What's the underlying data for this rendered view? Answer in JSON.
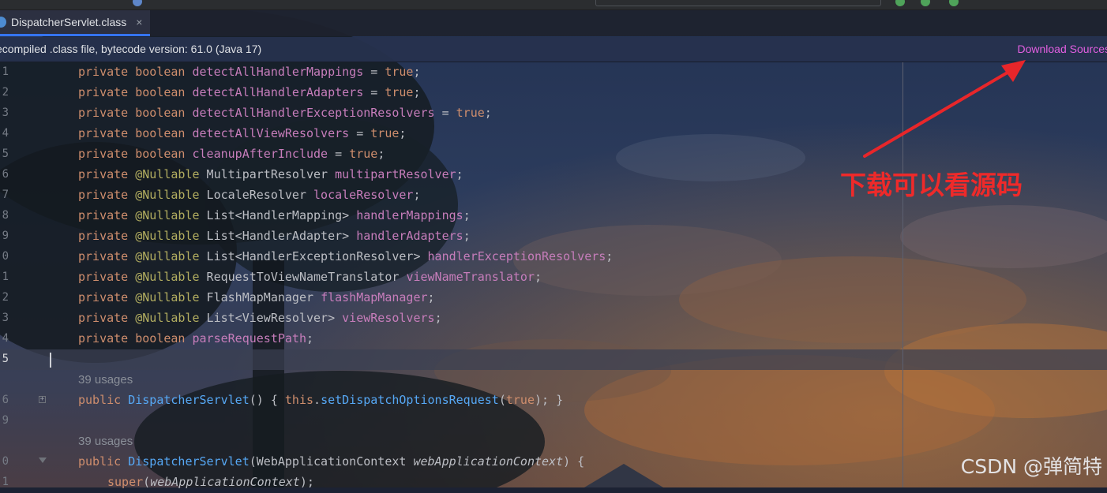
{
  "tab": {
    "label": "DispatcherServlet.class",
    "close_glyph": "×"
  },
  "notice": {
    "text": "ecompiled .class file, bytecode version: 61.0 (Java 17)",
    "action_label": "Download Sources"
  },
  "editor": {
    "lines": [
      {
        "number": "1",
        "tokens": [
          {
            "t": "private boolean ",
            "c": "kw"
          },
          {
            "t": "detectAllHandlerMappings",
            "c": "fld"
          },
          {
            "t": " = ",
            "c": ""
          },
          {
            "t": "true",
            "c": "kw"
          },
          {
            "t": ";",
            "c": ""
          }
        ]
      },
      {
        "number": "2",
        "tokens": [
          {
            "t": "private boolean ",
            "c": "kw"
          },
          {
            "t": "detectAllHandlerAdapters",
            "c": "fld"
          },
          {
            "t": " = ",
            "c": ""
          },
          {
            "t": "true",
            "c": "kw"
          },
          {
            "t": ";",
            "c": ""
          }
        ]
      },
      {
        "number": "3",
        "tokens": [
          {
            "t": "private boolean ",
            "c": "kw"
          },
          {
            "t": "detectAllHandlerExceptionResolvers",
            "c": "fld"
          },
          {
            "t": " = ",
            "c": ""
          },
          {
            "t": "true",
            "c": "kw"
          },
          {
            "t": ";",
            "c": ""
          }
        ]
      },
      {
        "number": "4",
        "tokens": [
          {
            "t": "private boolean ",
            "c": "kw"
          },
          {
            "t": "detectAllViewResolvers",
            "c": "fld"
          },
          {
            "t": " = ",
            "c": ""
          },
          {
            "t": "true",
            "c": "kw"
          },
          {
            "t": ";",
            "c": ""
          }
        ]
      },
      {
        "number": "5",
        "tokens": [
          {
            "t": "private boolean ",
            "c": "kw"
          },
          {
            "t": "cleanupAfterInclude",
            "c": "fld"
          },
          {
            "t": " = ",
            "c": ""
          },
          {
            "t": "true",
            "c": "kw"
          },
          {
            "t": ";",
            "c": ""
          }
        ]
      },
      {
        "number": "6",
        "tokens": [
          {
            "t": "private ",
            "c": "kw"
          },
          {
            "t": "@Nullable",
            "c": "ann"
          },
          {
            "t": " MultipartResolver ",
            "c": ""
          },
          {
            "t": "multipartResolver",
            "c": "fld"
          },
          {
            "t": ";",
            "c": ""
          }
        ]
      },
      {
        "number": "7",
        "tokens": [
          {
            "t": "private ",
            "c": "kw"
          },
          {
            "t": "@Nullable",
            "c": "ann"
          },
          {
            "t": " LocaleResolver ",
            "c": ""
          },
          {
            "t": "localeResolver",
            "c": "fld"
          },
          {
            "t": ";",
            "c": ""
          }
        ]
      },
      {
        "number": "8",
        "tokens": [
          {
            "t": "private ",
            "c": "kw"
          },
          {
            "t": "@Nullable",
            "c": "ann"
          },
          {
            "t": " List<HandlerMapping> ",
            "c": ""
          },
          {
            "t": "handlerMappings",
            "c": "fld"
          },
          {
            "t": ";",
            "c": ""
          }
        ]
      },
      {
        "number": "9",
        "tokens": [
          {
            "t": "private ",
            "c": "kw"
          },
          {
            "t": "@Nullable",
            "c": "ann"
          },
          {
            "t": " List<HandlerAdapter> ",
            "c": ""
          },
          {
            "t": "handlerAdapters",
            "c": "fld"
          },
          {
            "t": ";",
            "c": ""
          }
        ]
      },
      {
        "number": "0",
        "tokens": [
          {
            "t": "private ",
            "c": "kw"
          },
          {
            "t": "@Nullable",
            "c": "ann"
          },
          {
            "t": " List<HandlerExceptionResolver> ",
            "c": ""
          },
          {
            "t": "handlerExceptionResolvers",
            "c": "fld"
          },
          {
            "t": ";",
            "c": ""
          }
        ]
      },
      {
        "number": "1",
        "tokens": [
          {
            "t": "private ",
            "c": "kw"
          },
          {
            "t": "@Nullable",
            "c": "ann"
          },
          {
            "t": " RequestToViewNameTranslator ",
            "c": ""
          },
          {
            "t": "viewNameTranslator",
            "c": "fld"
          },
          {
            "t": ";",
            "c": ""
          }
        ]
      },
      {
        "number": "2",
        "tokens": [
          {
            "t": "private ",
            "c": "kw"
          },
          {
            "t": "@Nullable",
            "c": "ann"
          },
          {
            "t": " FlashMapManager ",
            "c": ""
          },
          {
            "t": "flashMapManager",
            "c": "fld"
          },
          {
            "t": ";",
            "c": ""
          }
        ]
      },
      {
        "number": "3",
        "tokens": [
          {
            "t": "private ",
            "c": "kw"
          },
          {
            "t": "@Nullable",
            "c": "ann"
          },
          {
            "t": " List<ViewResolver> ",
            "c": ""
          },
          {
            "t": "viewResolvers",
            "c": "fld"
          },
          {
            "t": ";",
            "c": ""
          }
        ]
      },
      {
        "number": "4",
        "tokens": [
          {
            "t": "private boolean ",
            "c": "kw"
          },
          {
            "t": "parseRequestPath",
            "c": "fld"
          },
          {
            "t": ";",
            "c": ""
          }
        ]
      },
      {
        "number": "5",
        "active": true,
        "tokens": []
      },
      {
        "usages": "39 usages"
      },
      {
        "number": "6",
        "fold": "plus",
        "tokens": [
          {
            "t": "public ",
            "c": "kw"
          },
          {
            "t": "DispatcherServlet",
            "c": "met"
          },
          {
            "t": "() { ",
            "c": ""
          },
          {
            "t": "this",
            "c": "kw"
          },
          {
            "t": ".",
            "c": ""
          },
          {
            "t": "setDispatchOptionsRequest",
            "c": "met"
          },
          {
            "t": "(",
            "c": ""
          },
          {
            "t": "true",
            "c": "kw"
          },
          {
            "t": "); }",
            "c": ""
          }
        ]
      },
      {
        "number": "9",
        "tokens": []
      },
      {
        "usages": "39 usages"
      },
      {
        "number": "0",
        "fold": "minus",
        "tokens": [
          {
            "t": "public ",
            "c": "kw"
          },
          {
            "t": "DispatcherServlet",
            "c": "met"
          },
          {
            "t": "(WebApplicationContext ",
            "c": ""
          },
          {
            "t": "webApplicationContext",
            "c": "prm"
          },
          {
            "t": ") {",
            "c": ""
          }
        ]
      },
      {
        "number": "1",
        "indent": true,
        "tokens": [
          {
            "t": "super",
            "c": "kw"
          },
          {
            "t": "(",
            "c": ""
          },
          {
            "t": "webApplicationContext",
            "c": "prm"
          },
          {
            "t": ");",
            "c": ""
          }
        ]
      }
    ]
  },
  "annotation": {
    "callout": "下载可以看源码"
  },
  "watermark": "CSDN @弹简特",
  "colors": {
    "keyword": "#cf8e6d",
    "field": "#c77dbb",
    "annotation": "#b3ae60",
    "method": "#56a8f5",
    "link": "#e25fe0",
    "callout": "#ee2a2a",
    "tab_underline": "#3574f0"
  }
}
